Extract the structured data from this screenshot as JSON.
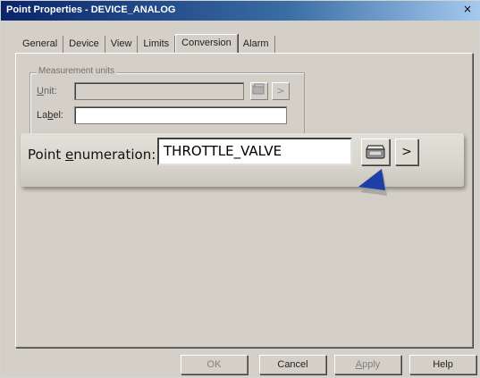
{
  "window": {
    "title": "Point Properties - DEVICE_ANALOG",
    "close_glyph": "×"
  },
  "tabs": [
    {
      "label": "General",
      "active": false
    },
    {
      "label": "Device",
      "active": false
    },
    {
      "label": "View",
      "active": false
    },
    {
      "label": "Limits",
      "active": false
    },
    {
      "label": "Conversion",
      "active": true
    },
    {
      "label": "Alarm",
      "active": false
    }
  ],
  "measurement_units": {
    "legend": "Measurement units",
    "unit_label_pre": "",
    "unit_label_acc": "U",
    "unit_label_post": "nit:",
    "unit_value": "",
    "label_label_pre": "La",
    "label_label_acc": "b",
    "label_label_post": "el:",
    "label_value": "",
    "browse_icon": "folder-browse-icon",
    "arrow_glyph": ">"
  },
  "point_enumeration": {
    "label_pre": "Point ",
    "label_acc": "e",
    "label_post": "numeration:",
    "value": "THROTTLE_VALVE",
    "browse_icon": "folder-browse-icon",
    "arrow_glyph": ">"
  },
  "buttons": {
    "ok": "OK",
    "cancel": "Cancel",
    "apply_pre": "",
    "apply_acc": "A",
    "apply_post": "pply",
    "help": "Help"
  },
  "colors": {
    "title_start": "#0a246a",
    "title_end": "#a6caf0",
    "face": "#d4d0c8",
    "pointer": "#1f3fa8"
  }
}
